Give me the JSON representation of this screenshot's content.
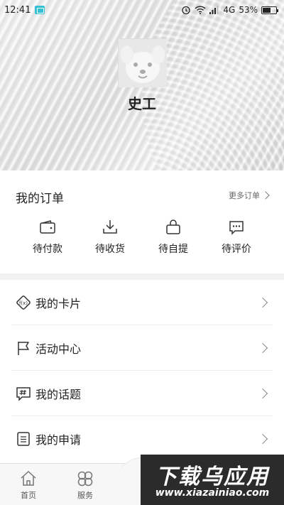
{
  "status_bar": {
    "time": "12:41",
    "network": "4G",
    "battery": "53%"
  },
  "profile": {
    "name": "史工"
  },
  "orders": {
    "title": "我的订单",
    "more_label": "更多订单",
    "items": [
      {
        "label": "待付款",
        "icon": "wallet-icon"
      },
      {
        "label": "待收货",
        "icon": "download-icon"
      },
      {
        "label": "待自提",
        "icon": "bag-icon"
      },
      {
        "label": "待评价",
        "icon": "comment-icon"
      }
    ]
  },
  "menu": [
    {
      "label": "我的卡片",
      "icon": "card-icon"
    },
    {
      "label": "活动中心",
      "icon": "flag-icon"
    },
    {
      "label": "我的话题",
      "icon": "hashtag-icon"
    },
    {
      "label": "我的申请",
      "icon": "document-icon"
    }
  ],
  "bottom_nav": [
    {
      "label": "首页",
      "icon": "home-icon"
    },
    {
      "label": "服务",
      "icon": "grid-icon"
    }
  ],
  "watermark": {
    "title": "下载乌应用",
    "url": "www.xiazainiao.com"
  }
}
